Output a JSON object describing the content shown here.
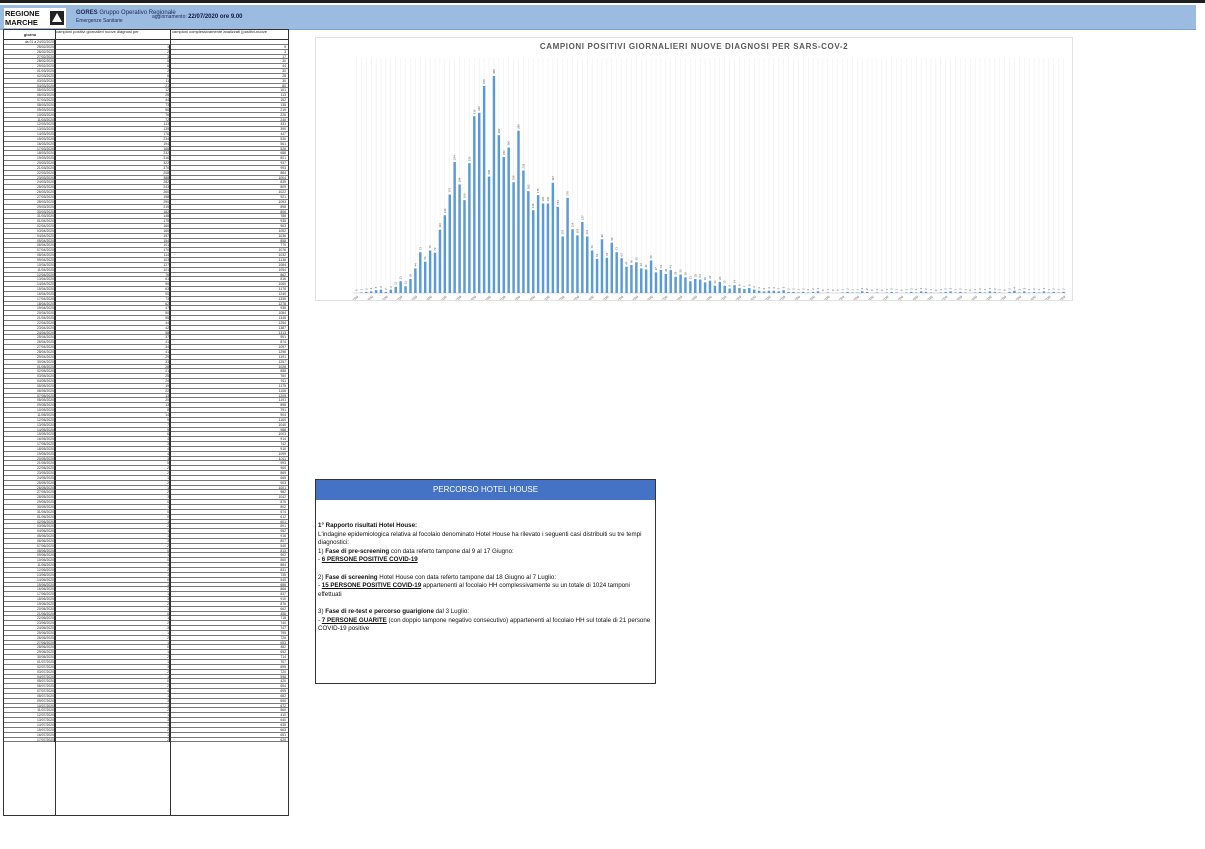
{
  "header": {
    "logo_text": "REGIONE MARCHE",
    "org": "GORES",
    "org_desc": "Gruppo Operativo Regionale",
    "org_sub": "Emergenze Sanitarie",
    "update_label": "aggiornamento:",
    "update_value": "22/07/2020 ore 9.00",
    "bar_color": "#9cbbe0"
  },
  "table": {
    "headers": [
      "giorno",
      "campioni positivi giornalieri nuove diagnosi per",
      "campioni complessivamente analizzati (positivi-nuove"
    ],
    "first_label": "da 01 a 24/02/2020",
    "rows": [
      [
        "25/02/2020",
        "1",
        "9"
      ],
      [
        "26/02/2020",
        "2",
        "3"
      ],
      [
        "27/02/2020",
        "3",
        "17"
      ],
      [
        "28/02/2020",
        "5",
        "30"
      ],
      [
        "29/02/2020",
        "6",
        "44"
      ],
      [
        "01/03/2020",
        "2",
        "30"
      ],
      [
        "02/03/2020",
        "6",
        "28"
      ],
      [
        "03/03/2020",
        "11",
        "30"
      ],
      [
        "04/03/2020",
        "21",
        "80"
      ],
      [
        "05/03/2020",
        "12",
        "101"
      ],
      [
        "06/03/2020",
        "25",
        "113"
      ],
      [
        "07/03/2020",
        "44",
        "152"
      ],
      [
        "08/03/2020",
        "73",
        "135"
      ],
      [
        "09/03/2020",
        "56",
        "219"
      ],
      [
        "10/03/2020",
        "76",
        "226"
      ],
      [
        "11/03/2020",
        "72",
        "240"
      ],
      [
        "12/03/2020",
        "113",
        "331"
      ],
      [
        "13/03/2020",
        "139",
        "390"
      ],
      [
        "14/03/2020",
        "176",
        "447"
      ],
      [
        "15/03/2020",
        "234",
        "530"
      ],
      [
        "16/03/2020",
        "194",
        "561"
      ],
      [
        "17/03/2020",
        "166",
        "526"
      ],
      [
        "18/03/2020",
        "232",
        "688"
      ],
      [
        "19/03/2020",
        "316",
        "801"
      ],
      [
        "20/03/2020",
        "322",
        "937"
      ],
      [
        "21/03/2020",
        "370",
        "993"
      ],
      [
        "22/03/2020",
        "208",
        "884"
      ],
      [
        "23/03/2020",
        "388",
        "1004"
      ],
      [
        "24/03/2020",
        "282",
        "839"
      ],
      [
        "25/03/2020",
        "243",
        "809"
      ],
      [
        "26/03/2020",
        "260",
        "1022"
      ],
      [
        "27/03/2020",
        "198",
        "921"
      ],
      [
        "28/03/2020",
        "290",
        "1093"
      ],
      [
        "29/03/2020",
        "219",
        "898"
      ],
      [
        "30/03/2020",
        "182",
        "806"
      ],
      [
        "31/03/2020",
        "148",
        "788"
      ],
      [
        "01/04/2020",
        "175",
        "935"
      ],
      [
        "02/04/2020",
        "160",
        "963"
      ],
      [
        "03/04/2020",
        "160",
        "1052"
      ],
      [
        "04/04/2020",
        "197",
        "1036"
      ],
      [
        "05/04/2020",
        "154",
        "858"
      ],
      [
        "06/04/2020",
        "101",
        "770"
      ],
      [
        "07/04/2020",
        "170",
        "1076"
      ],
      [
        "08/04/2020",
        "114",
        "1032"
      ],
      [
        "09/04/2020",
        "103",
        "1136"
      ],
      [
        "10/04/2020",
        "127",
        "1084"
      ],
      [
        "11/04/2020",
        "101",
        "1054"
      ],
      [
        "12/04/2020",
        "76",
        "862"
      ],
      [
        "13/04/2020",
        "61",
        "816"
      ],
      [
        "14/04/2020",
        "96",
        "1060"
      ],
      [
        "15/04/2020",
        "63",
        "1178"
      ],
      [
        "16/04/2020",
        "90",
        "1240"
      ],
      [
        "17/04/2020",
        "73",
        "1335"
      ],
      [
        "18/04/2020",
        "62",
        "1278"
      ],
      [
        "19/04/2020",
        "47",
        "936"
      ],
      [
        "20/04/2020",
        "50",
        "1084"
      ],
      [
        "21/04/2020",
        "55",
        "1345"
      ],
      [
        "22/04/2020",
        "44",
        "1254"
      ],
      [
        "23/04/2020",
        "42",
        "1387"
      ],
      [
        "24/04/2020",
        "58",
        "1313"
      ],
      [
        "25/04/2020",
        "37",
        "991"
      ],
      [
        "26/04/2020",
        "41",
        "874"
      ],
      [
        "27/04/2020",
        "34",
        "1097"
      ],
      [
        "28/04/2020",
        "41",
        "1296"
      ],
      [
        "29/04/2020",
        "29",
        "1191"
      ],
      [
        "30/04/2020",
        "33",
        "1257"
      ],
      [
        "01/05/2020",
        "28",
        "1028"
      ],
      [
        "02/05/2020",
        "21",
        "888"
      ],
      [
        "03/05/2020",
        "25",
        "760"
      ],
      [
        "04/05/2020",
        "24",
        "911"
      ],
      [
        "05/05/2020",
        "19",
        "1175"
      ],
      [
        "06/05/2020",
        "22",
        "1108"
      ],
      [
        "07/05/2020",
        "13",
        "1205"
      ],
      [
        "08/05/2020",
        "20",
        "1191"
      ],
      [
        "09/05/2020",
        "13",
        "898"
      ],
      [
        "10/05/2020",
        "8",
        "791"
      ],
      [
        "11/05/2020",
        "14",
        "904"
      ],
      [
        "12/05/2020",
        "9",
        "1160"
      ],
      [
        "13/05/2020",
        "7",
        "1040"
      ],
      [
        "14/05/2020",
        "9",
        "988"
      ],
      [
        "15/05/2020",
        "6",
        "1003"
      ],
      [
        "16/05/2020",
        "4",
        "914"
      ],
      [
        "17/05/2020",
        "3",
        "742"
      ],
      [
        "18/05/2020",
        "4",
        "910"
      ],
      [
        "19/05/2020",
        "4",
        "1099"
      ],
      [
        "20/05/2020",
        "3",
        "1011"
      ],
      [
        "21/05/2020",
        "5",
        "993"
      ],
      [
        "22/05/2020",
        "2",
        "960"
      ],
      [
        "23/05/2020",
        "2",
        "869"
      ],
      [
        "24/05/2020",
        "1",
        "665"
      ],
      [
        "25/05/2020",
        "2",
        "903"
      ],
      [
        "26/05/2020",
        "1",
        "1001"
      ],
      [
        "27/05/2020",
        "2",
        "982"
      ],
      [
        "28/05/2020",
        "3",
        "1042"
      ],
      [
        "29/05/2020",
        "0",
        "875"
      ],
      [
        "30/05/2020",
        "1",
        "802"
      ],
      [
        "31/05/2020",
        "0",
        "574"
      ],
      [
        "01/06/2020",
        "0",
        "612"
      ],
      [
        "02/06/2020",
        "1",
        "601"
      ],
      [
        "03/06/2020",
        "2",
        "891"
      ],
      [
        "04/06/2020",
        "1",
        "952"
      ],
      [
        "05/06/2020",
        "1",
        "916"
      ],
      [
        "06/06/2020",
        "3",
        "807"
      ],
      [
        "07/06/2020",
        "2",
        "540"
      ],
      [
        "08/06/2020",
        "0",
        "813"
      ],
      [
        "09/06/2020",
        "1",
        "902"
      ],
      [
        "10/06/2020",
        "0",
        "860"
      ],
      [
        "11/06/2020",
        "1",
        "884"
      ],
      [
        "12/06/2020",
        "2",
        "831"
      ],
      [
        "13/06/2020",
        "1",
        "735"
      ],
      [
        "14/06/2020",
        "0",
        "545"
      ],
      [
        "15/06/2020",
        "1",
        "686"
      ],
      [
        "16/06/2020",
        "2",
        "866"
      ],
      [
        "17/06/2020",
        "1",
        "837"
      ],
      [
        "18/06/2020",
        "3",
        "910"
      ],
      [
        "19/06/2020",
        "2",
        "876"
      ],
      [
        "20/06/2020",
        "1",
        "662"
      ],
      [
        "21/06/2020",
        "0",
        "456"
      ],
      [
        "22/06/2020",
        "1",
        "718"
      ],
      [
        "23/06/2020",
        "2",
        "740"
      ],
      [
        "24/06/2020",
        "3",
        "747"
      ],
      [
        "25/06/2020",
        "1",
        "795"
      ],
      [
        "26/06/2020",
        "2",
        "726"
      ],
      [
        "27/06/2020",
        "1",
        "653"
      ],
      [
        "28/06/2020",
        "0",
        "482"
      ],
      [
        "29/06/2020",
        "1",
        "692"
      ],
      [
        "30/06/2020",
        "2",
        "714"
      ],
      [
        "01/07/2020",
        "1",
        "707"
      ],
      [
        "02/07/2020",
        "3",
        "695"
      ],
      [
        "03/07/2020",
        "2",
        "720"
      ],
      [
        "04/07/2020",
        "1",
        "598"
      ],
      [
        "05/07/2020",
        "0",
        "420"
      ],
      [
        "06/07/2020",
        "2",
        "654"
      ],
      [
        "07/07/2020",
        "4",
        "699"
      ],
      [
        "08/07/2020",
        "1",
        "682"
      ],
      [
        "09/07/2020",
        "3",
        "690"
      ],
      [
        "10/07/2020",
        "1",
        "672"
      ],
      [
        "11/07/2020",
        "2",
        "560"
      ],
      [
        "12/07/2020",
        "1",
        "410"
      ],
      [
        "13/07/2020",
        "3",
        "640"
      ],
      [
        "14/07/2020",
        "1",
        "635"
      ],
      [
        "15/07/2020",
        "2",
        "663"
      ],
      [
        "16/07/2020",
        "1",
        "651"
      ],
      [
        "17/07/2020",
        "2",
        "620"
      ]
    ]
  },
  "chart_data": {
    "type": "bar",
    "title": "CAMPIONI POSITIVI GIORNALIERI NUOVE DIAGNOSI PER SARS-COV-2",
    "xlabel": "",
    "ylabel": "",
    "bar_color": "#5b9bd5",
    "ylim": [
      0,
      420
    ],
    "categories": [
      "da 01 a 24/02/2020",
      "25/02/2020",
      "26/02/2020",
      "27/02/2020",
      "28/02/2020",
      "29/02/2020",
      "01/03/2020",
      "02/03/2020",
      "03/03/2020",
      "04/03/2020",
      "05/03/2020",
      "06/03/2020",
      "07/03/2020",
      "08/03/2020",
      "09/03/2020",
      "10/03/2020",
      "11/03/2020",
      "12/03/2020",
      "13/03/2020",
      "14/03/2020",
      "15/03/2020",
      "16/03/2020",
      "17/03/2020",
      "18/03/2020",
      "19/03/2020",
      "20/03/2020",
      "21/03/2020",
      "22/03/2020",
      "23/03/2020",
      "24/03/2020",
      "25/03/2020",
      "26/03/2020",
      "27/03/2020",
      "28/03/2020",
      "29/03/2020",
      "30/03/2020",
      "31/03/2020",
      "01/04/2020",
      "02/04/2020",
      "03/04/2020",
      "04/04/2020",
      "05/04/2020",
      "06/04/2020",
      "07/04/2020",
      "08/04/2020",
      "09/04/2020",
      "10/04/2020",
      "11/04/2020",
      "12/04/2020",
      "13/04/2020",
      "14/04/2020",
      "15/04/2020",
      "16/04/2020",
      "17/04/2020",
      "18/04/2020",
      "19/04/2020",
      "20/04/2020",
      "21/04/2020",
      "22/04/2020",
      "23/04/2020",
      "24/04/2020",
      "25/04/2020",
      "26/04/2020",
      "27/04/2020",
      "28/04/2020",
      "29/04/2020",
      "30/04/2020",
      "01/05/2020",
      "02/05/2020",
      "03/05/2020",
      "04/05/2020",
      "05/05/2020",
      "06/05/2020",
      "07/05/2020",
      "08/05/2020",
      "09/05/2020",
      "10/05/2020",
      "11/05/2020",
      "12/05/2020",
      "13/05/2020",
      "14/05/2020",
      "15/05/2020",
      "16/05/2020",
      "17/05/2020",
      "18/05/2020",
      "19/05/2020",
      "20/05/2020",
      "21/05/2020",
      "22/05/2020",
      "23/05/2020",
      "24/05/2020",
      "25/05/2020",
      "26/05/2020",
      "27/05/2020",
      "28/05/2020",
      "29/05/2020",
      "30/05/2020",
      "31/05/2020",
      "01/06/2020",
      "02/06/2020",
      "03/06/2020",
      "04/06/2020",
      "05/06/2020",
      "06/06/2020",
      "07/06/2020",
      "08/06/2020",
      "09/06/2020",
      "10/06/2020",
      "11/06/2020",
      "12/06/2020",
      "13/06/2020",
      "14/06/2020",
      "15/06/2020",
      "16/06/2020",
      "17/06/2020",
      "18/06/2020",
      "19/06/2020",
      "20/06/2020",
      "21/06/2020",
      "22/06/2020",
      "23/06/2020",
      "24/06/2020",
      "25/06/2020",
      "26/06/2020",
      "27/06/2020",
      "28/06/2020",
      "29/06/2020",
      "30/06/2020",
      "01/07/2020",
      "02/07/2020",
      "03/07/2020",
      "04/07/2020",
      "05/07/2020",
      "06/07/2020",
      "07/07/2020",
      "08/07/2020",
      "09/07/2020",
      "10/07/2020",
      "11/07/2020",
      "12/07/2020",
      "13/07/2020",
      "14/07/2020",
      "15/07/2020",
      "16/07/2020",
      "17/07/2020"
    ],
    "values": [
      0,
      1,
      2,
      3,
      5,
      6,
      2,
      6,
      11,
      21,
      12,
      25,
      44,
      73,
      56,
      76,
      72,
      113,
      139,
      176,
      234,
      194,
      166,
      232,
      316,
      322,
      370,
      208,
      388,
      282,
      243,
      260,
      198,
      290,
      219,
      182,
      148,
      175,
      160,
      160,
      197,
      154,
      101,
      170,
      114,
      103,
      127,
      101,
      76,
      61,
      96,
      63,
      90,
      73,
      62,
      47,
      50,
      55,
      44,
      42,
      58,
      37,
      41,
      34,
      41,
      29,
      33,
      28,
      21,
      25,
      24,
      19,
      22,
      13,
      20,
      13,
      8,
      14,
      9,
      7,
      9,
      6,
      4,
      3,
      4,
      4,
      3,
      5,
      2,
      2,
      1,
      2,
      1,
      2,
      3,
      0,
      1,
      0,
      0,
      1,
      2,
      1,
      1,
      3,
      2,
      0,
      1,
      0,
      1,
      2,
      1,
      0,
      1,
      2,
      1,
      3,
      2,
      1,
      0,
      1,
      2,
      3,
      1,
      2,
      1,
      0,
      1,
      2,
      1,
      3,
      2,
      1,
      0,
      2,
      4,
      1,
      3,
      1,
      2,
      1,
      3,
      1,
      2,
      1,
      2
    ]
  },
  "hotel_house": {
    "title": "PERCORSO HOTEL HOUSE",
    "report_title": "1° Rapporto  risultati Hotel House:",
    "intro": "L'indagine epidemiologica relativa al focolaio denominato Hotel House ha rilevato i seguenti casi distribuiti su tre tempi diagnostici:",
    "phase1_prefix": "1) ",
    "phase1_bold": "Fase di pre-screening",
    "phase1_text": " con data referto tampone dal 9 al 17 Giugno:",
    "phase1_dash": "- ",
    "phase1_result": "6 PERSONE POSITIVE COVID-19",
    "phase2_prefix": "2) ",
    "phase2_bold": "Fase di screening",
    "phase2_text": " Hotel House con data referto tampone dal 18 Giugno al 7 Luglio:",
    "phase2_dash": "- ",
    "phase2_result": "15 PERSONE POSITIVE COVID-19",
    "phase2_rest": " appartenenti al focolaio HH complessivamente su un totale di 1024 tamponi effettuati",
    "phase3_prefix": "3) ",
    "phase3_bold": "Fase di re-test e percorso guarigione",
    "phase3_text": " dal 3 Luglio:",
    "phase3_dash": "- ",
    "phase3_result": "7 PERSONE GUARITE",
    "phase3_rest": " (con doppio tampone negativo consecutivo) appartenenti al focolaio HH sul totale di 21 persone COVID-19 positive",
    "title_bg": "#4472c4"
  }
}
